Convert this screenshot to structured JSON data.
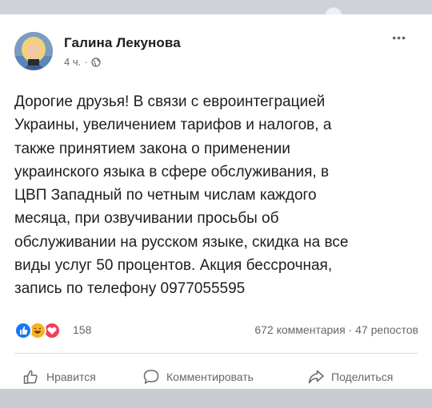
{
  "post": {
    "author": "Галина Лекунова",
    "time": "4 ч.",
    "dot": "·",
    "more": "•••",
    "text": "Дорогие друзья! В связи с евроинтеграцией\nУкраины, увеличением тарифов и налогов, а\nтакже принятием закона о применении\nукраинского языка в сфере обслуживания, в\nЦВП Западный по четным числам каждого\nмесяца, при озвучивании просьбы об\nобслуживании на русском языке, скидка на все\nвиды услуг 50 процентов. Акция бессрочная,\nзапись по телефону 0977055595"
  },
  "reactions": {
    "count": "158",
    "icons": [
      "like-icon",
      "haha-icon",
      "love-icon"
    ],
    "stats": "672 комментария · 47 репостов"
  },
  "actions": {
    "like": "Нравится",
    "comment": "Комментировать",
    "share": "Поделиться"
  },
  "colors": {
    "like": "#1877f2",
    "haha": "#f7b125",
    "love": "#f33e58",
    "meta": "#65676b"
  }
}
